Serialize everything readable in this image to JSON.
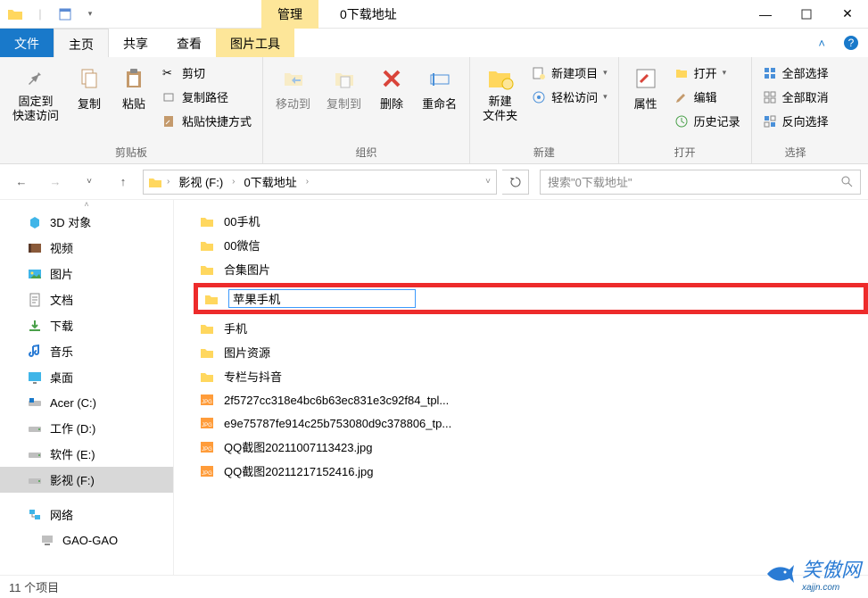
{
  "window": {
    "title": "0下载地址",
    "manage_tab": "管理"
  },
  "ribbon_tabs": {
    "file": "文件",
    "home": "主页",
    "share": "共享",
    "view": "查看",
    "picture_tools": "图片工具"
  },
  "ribbon": {
    "clipboard": {
      "pin": "固定到\n快速访问",
      "copy": "复制",
      "paste": "粘贴",
      "cut": "剪切",
      "copy_path": "复制路径",
      "paste_shortcut": "粘贴快捷方式",
      "group_label": "剪贴板"
    },
    "organize": {
      "move_to": "移动到",
      "copy_to": "复制到",
      "delete": "删除",
      "rename": "重命名",
      "group_label": "组织"
    },
    "new": {
      "new_folder": "新建\n文件夹",
      "new_item": "新建项目",
      "easy_access": "轻松访问",
      "group_label": "新建"
    },
    "open": {
      "properties": "属性",
      "open": "打开",
      "edit": "编辑",
      "history": "历史记录",
      "group_label": "打开"
    },
    "select": {
      "select_all": "全部选择",
      "select_none": "全部取消",
      "invert": "反向选择",
      "group_label": "选择"
    }
  },
  "breadcrumb": {
    "seg1": "影视 (F:)",
    "seg2": "0下载地址"
  },
  "search": {
    "placeholder": "搜索\"0下载地址\""
  },
  "sidebar": [
    {
      "label": "3D 对象",
      "icon": "3d"
    },
    {
      "label": "视频",
      "icon": "video"
    },
    {
      "label": "图片",
      "icon": "picture"
    },
    {
      "label": "文档",
      "icon": "document"
    },
    {
      "label": "下载",
      "icon": "download"
    },
    {
      "label": "音乐",
      "icon": "music"
    },
    {
      "label": "桌面",
      "icon": "desktop"
    },
    {
      "label": "Acer (C:)",
      "icon": "osdrive"
    },
    {
      "label": "工作 (D:)",
      "icon": "drive"
    },
    {
      "label": "软件 (E:)",
      "icon": "drive"
    },
    {
      "label": "影视 (F:)",
      "icon": "drive",
      "selected": true
    },
    {
      "label": "网络",
      "icon": "network",
      "gap": true
    },
    {
      "label": "GAO-GAO",
      "icon": "pc",
      "lvl": 2
    }
  ],
  "files": [
    {
      "name": "00手机",
      "type": "folder"
    },
    {
      "name": "00微信",
      "type": "folder"
    },
    {
      "name": "合集图片",
      "type": "folder"
    },
    {
      "name": "苹果手机",
      "type": "folder",
      "renaming": true
    },
    {
      "name": "手机",
      "type": "folder"
    },
    {
      "name": "图片资源",
      "type": "folder"
    },
    {
      "name": "专栏与抖音",
      "type": "folder"
    },
    {
      "name": "2f5727cc318e4bc6b63ec831e3c92f84_tpl...",
      "type": "image"
    },
    {
      "name": "e9e75787fe914c25b753080d9c378806_tp...",
      "type": "image"
    },
    {
      "name": "QQ截图20211007113423.jpg",
      "type": "image"
    },
    {
      "name": "QQ截图20211217152416.jpg",
      "type": "image"
    }
  ],
  "status": {
    "item_count": "11 个项目"
  },
  "watermark": {
    "text": "笑傲网",
    "sub": "xajjn.com"
  }
}
